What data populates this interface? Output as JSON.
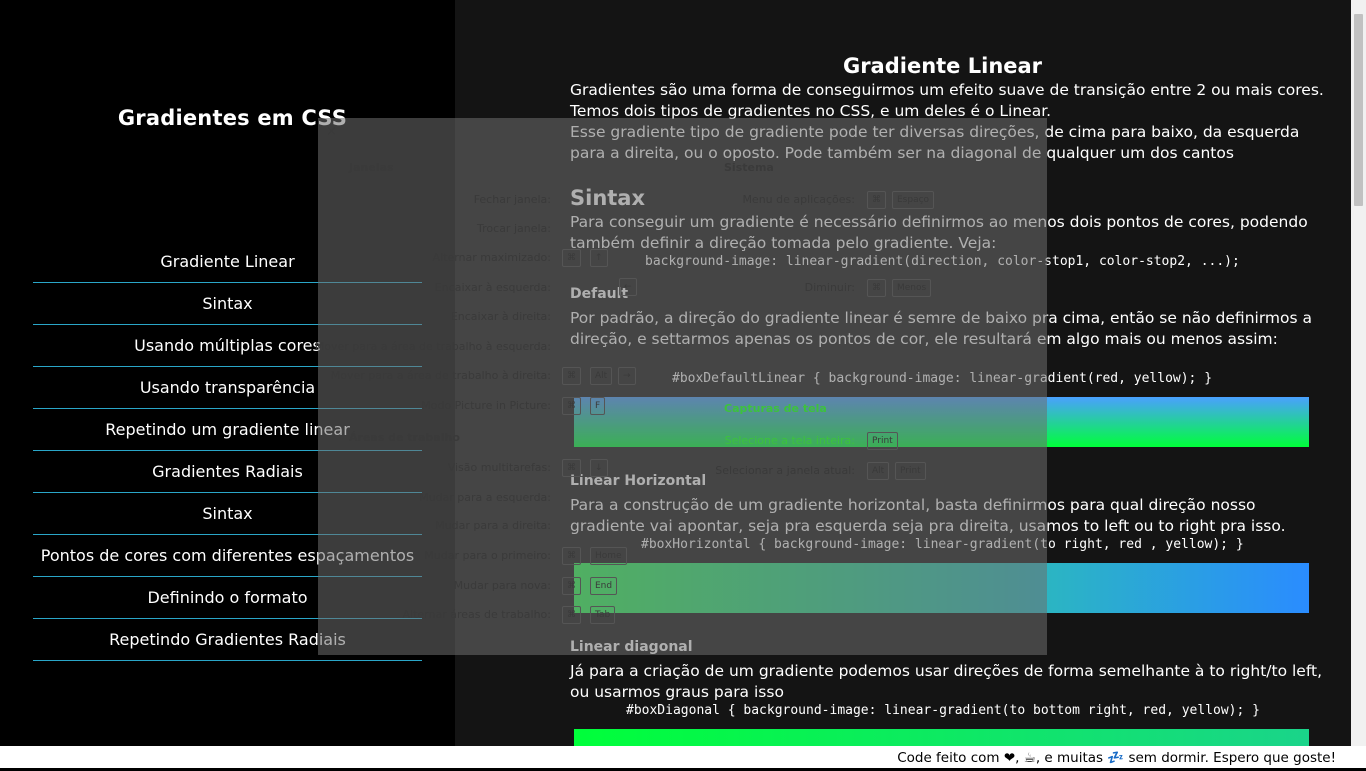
{
  "sidebar": {
    "title": "Gradientes em CSS",
    "items": [
      "Gradiente Linear",
      "Sintax",
      "Usando múltiplas cores",
      "Usando transparência",
      "Repetindo um gradiente linear",
      "Gradientes Radiais",
      "Sintax",
      "Pontos de cores com diferentes espaçamentos",
      "Definindo o formato",
      "Repetindo Gradientes Radiais"
    ]
  },
  "main": {
    "title": "Gradiente Linear",
    "intro1": "Gradientes são uma forma de conseguirmos um efeito suave de transição entre 2 ou mais cores. Temos dois tipos de gradientes no CSS, e um deles é o Linear.",
    "intro2": "Esse gradiente tipo de gradiente pode ter diversas direções, de cima para baixo, da esquerda para a direita, ou o oposto. Pode também ser na diagonal de qualquer um dos cantos",
    "sintax_title": "Sintax",
    "sintax_text": "Para conseguir um gradiente é necessário definirmos ao menos dois pontos de cores, podendo também definir a direção tomada pelo gradiente. Veja:",
    "sintax_code": "background-image: linear-gradient(direction, color-stop1, color-stop2, ...);",
    "default_title": "Default",
    "default_text": "Por padrão, a direção do gradiente linear é semre de baixo pra cima, então se não definirmos a direção, e settarmos apenas os pontos de cor, ele resultará em algo mais ou menos assim:",
    "default_code": "#boxDefaultLinear { background-image: linear-gradient(red, yellow); }",
    "horizontal_title": "Linear Horizontal",
    "horizontal_text": "Para a construção de um gradiente horizontal, basta definirmos para qual direção nosso gradiente vai apontar, seja pra esquerda seja pra direita, usamos to left ou to right pra isso.",
    "horizontal_code": "#boxHorizontal { background-image: linear-gradient(to right, red , yellow); }",
    "diagonal_title": "Linear diagonal",
    "diagonal_text": "Já para a criação de um gradiente podemos usar direções de forma semelhante à to right/to left, ou usarmos graus para isso",
    "diagonal_code": "#boxDiagonal { background-image: linear-gradient(to bottom right, red, yellow); }"
  },
  "overlay": {
    "close": "×",
    "janelas_header": "Janelas",
    "sistema_header": "Sistema",
    "areas_header": "Áreas de trabalho",
    "capturas_header": "Capturas de tela",
    "left_rows": [
      {
        "label": "Fechar janela:",
        "keys": []
      },
      {
        "label": "Trocar janela:",
        "keys": []
      },
      {
        "label": "Alternar maximizado:",
        "keys": [
          "⌘",
          "↑"
        ]
      },
      {
        "label": "Encaixar à esquerda:",
        "keys": [
          "⌘",
          "←"
        ]
      },
      {
        "label": "Encaixar à direita:",
        "keys": []
      },
      {
        "label": "Mover para a área de trabalho à esquerda:",
        "keys": []
      },
      {
        "label": "Mover para a área de trabalho à direita:",
        "keys": [
          "⌘",
          "Alt",
          "→"
        ]
      },
      {
        "label": "Modo Picture in Picture:",
        "keys": [
          "⌘",
          "F"
        ]
      }
    ],
    "left_rows2": [
      {
        "label": "Visão multitarefas:",
        "keys": [
          "⌘",
          "↓"
        ]
      },
      {
        "label": "Mudar para a esquerda:",
        "keys": []
      },
      {
        "label": "Mudar para a direita:",
        "keys": []
      },
      {
        "label": "Mudar para o primeiro:",
        "keys": [
          "⌘",
          "Home"
        ]
      },
      {
        "label": "Mudar para nova:",
        "keys": [
          "⌘",
          "End"
        ]
      },
      {
        "label": "Alternar áreas de trabalho:",
        "keys": [
          "⌘",
          "Tab"
        ]
      }
    ],
    "right_rows": [
      {
        "label": "Menu de aplicações:",
        "keys": [
          "⌘",
          "Espaço"
        ]
      },
      {
        "label": "Diminuir:",
        "keys": [
          "⌘",
          "Menos"
        ]
      }
    ],
    "right_rows2": [
      {
        "label": "Selecione a tela inteira:",
        "keys": [
          "Print"
        ]
      },
      {
        "label": "Selecionar a janela atual:",
        "keys": [
          "Alt",
          "Print"
        ]
      }
    ]
  },
  "footer": {
    "text": "Code feito com ❤, ☕, e muitas 💤 sem dormir. Espero que goste!"
  }
}
